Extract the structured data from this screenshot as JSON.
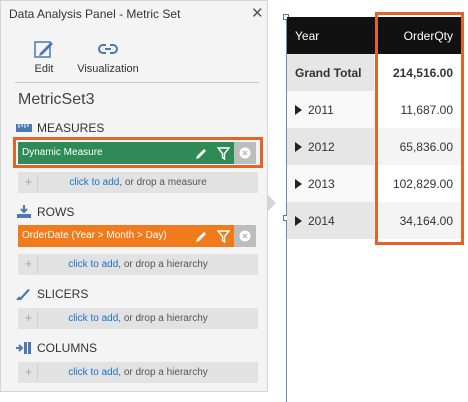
{
  "panel": {
    "title": "Data Analysis Panel - Metric Set",
    "close_glyph": "✕",
    "tools": [
      {
        "label": "Edit",
        "icon": "edit-icon"
      },
      {
        "label": "Visualization",
        "icon": "visualization-icon"
      }
    ],
    "set_name": "MetricSet3",
    "sections": {
      "measures": {
        "title": "MEASURES",
        "item": {
          "label": "Dynamic Measure",
          "color": "#2e8b57"
        },
        "drop": {
          "link": "click to add",
          "rest": ", or drop a measure"
        }
      },
      "rows": {
        "title": "ROWS",
        "item": {
          "label": "OrderDate (Year > Month > Day)",
          "color": "#f07b1d"
        },
        "drop": {
          "link": "click to add",
          "rest": ", or drop a hierarchy"
        }
      },
      "slicers": {
        "title": "SLICERS",
        "drop": {
          "link": "click to add",
          "rest": ", or drop a hierarchy"
        }
      },
      "columns": {
        "title": "COLUMNS",
        "drop": {
          "link": "click to add",
          "rest": ", or drop a hierarchy"
        }
      }
    },
    "highlight_color": "#e1642a"
  },
  "grid": {
    "headers": [
      "Year",
      "OrderQty"
    ],
    "total": {
      "label": "Grand Total",
      "value": "214,516.00"
    },
    "rows": [
      {
        "label": "2011",
        "value": "11,687.00"
      },
      {
        "label": "2012",
        "value": "65,836.00"
      },
      {
        "label": "2013",
        "value": "102,829.00"
      },
      {
        "label": "2014",
        "value": "34,164.00"
      }
    ]
  }
}
